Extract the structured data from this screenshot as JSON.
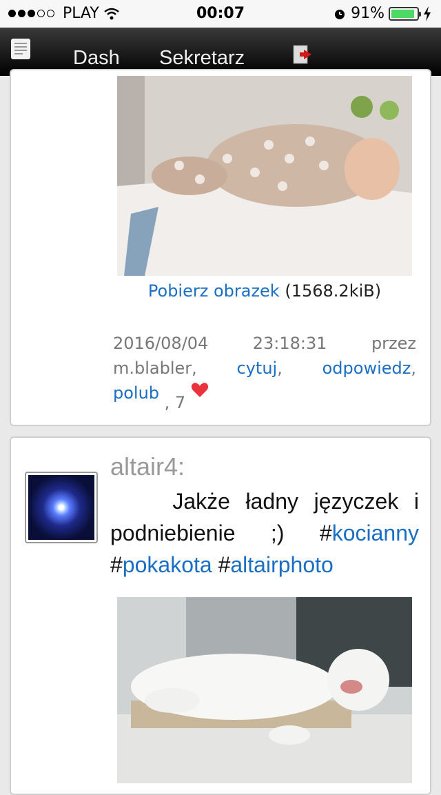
{
  "status_bar": {
    "carrier": "PLAY",
    "time": "00:07",
    "battery_percent": "91%",
    "battery_level": 0.91,
    "signal_dots_filled": 3,
    "signal_dots_total": 5
  },
  "nav": {
    "dash": "Dash",
    "sekretarz": "Sekretarz"
  },
  "post1": {
    "download_link": "Pobierz obrazek",
    "download_size": "(1568.2kiB)",
    "date": "2016/08/04",
    "time": "23:18:31",
    "by": "przez",
    "author": "m.blabler,",
    "quote": "cytuj",
    "reply": "odpowiedz",
    "like": "polub",
    "likes_count": ", 7"
  },
  "post2": {
    "author": "altair4:",
    "text": "Jakże ładny języczek i podniebienie ;)",
    "tags": [
      "kocianny",
      "pokakota",
      "altairphoto"
    ]
  },
  "colors": {
    "link": "#1a6fc4",
    "battery": "#4cd964"
  }
}
